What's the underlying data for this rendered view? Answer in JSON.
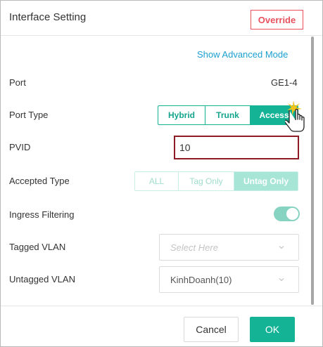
{
  "dialog": {
    "title": "Interface Setting",
    "override_label": "Override"
  },
  "advanced_link": "Show Advanced Mode",
  "fields": {
    "port": {
      "label": "Port",
      "value": "GE1-4"
    },
    "port_type": {
      "label": "Port Type",
      "options": [
        "Hybrid",
        "Trunk",
        "Access"
      ],
      "selected": "Access"
    },
    "pvid": {
      "label": "PVID",
      "value": "10"
    },
    "accepted_type": {
      "label": "Accepted Type",
      "options": [
        "ALL",
        "Tag Only",
        "Untag Only"
      ],
      "selected": "Untag Only",
      "disabled": true
    },
    "ingress_filtering": {
      "label": "Ingress Filtering",
      "enabled": true
    },
    "tagged_vlan": {
      "label": "Tagged VLAN",
      "placeholder": "Select Here"
    },
    "untagged_vlan": {
      "label": "Untagged VLAN",
      "value": "KinhDoanh(10)"
    }
  },
  "footer": {
    "cancel_label": "Cancel",
    "ok_label": "OK"
  },
  "colors": {
    "accent": "#14b396",
    "danger": "#e8515d",
    "link": "#1a9fd1",
    "highlight_border": "#8e1a24"
  },
  "icons": [
    "chevron-down-icon",
    "hand-cursor-icon"
  ]
}
